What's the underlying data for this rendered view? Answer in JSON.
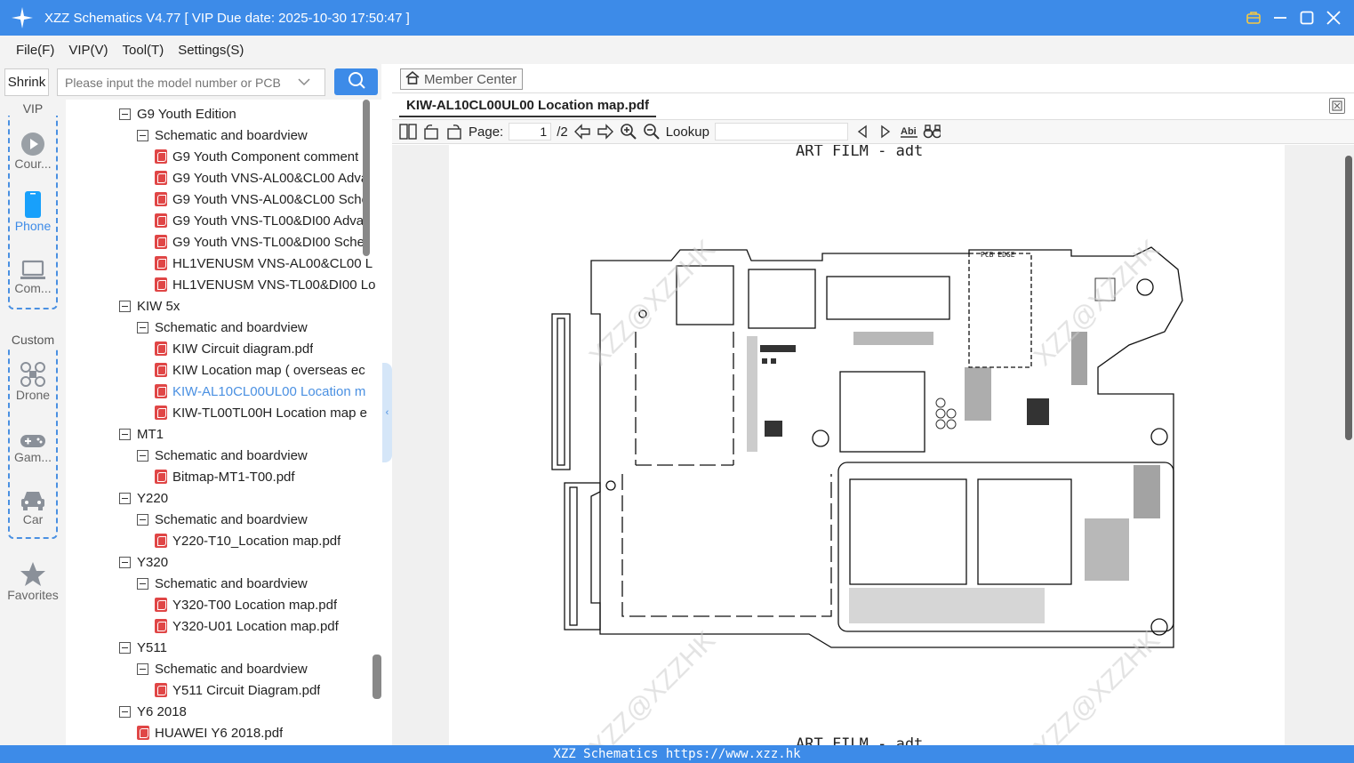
{
  "app": {
    "title": "XZZ Schematics V4.77 [ VIP Due date: 2025-10-30 17:50:47 ]",
    "menu": [
      "File(F)",
      "VIP(V)",
      "Tool(T)",
      "Settings(S)"
    ]
  },
  "search": {
    "shrink_label": "Shrink",
    "placeholder": "Please input the model number or PCB"
  },
  "sidebar": {
    "vip_label": "VIP",
    "custom_label": "Custom",
    "items": [
      {
        "label": "Cour...",
        "icon": "play-circle-icon"
      },
      {
        "label": "Phone",
        "icon": "phone-icon",
        "active": true
      },
      {
        "label": "Com...",
        "icon": "laptop-icon"
      },
      {
        "label": "Drone",
        "icon": "drone-icon"
      },
      {
        "label": "Gam...",
        "icon": "gamepad-icon"
      },
      {
        "label": "Car",
        "icon": "car-icon"
      },
      {
        "label": "Favorites",
        "icon": "star-icon"
      }
    ]
  },
  "tree": [
    {
      "label": "G9 Youth Edition",
      "type": "folder",
      "level": 0
    },
    {
      "label": "Schematic and boardview",
      "type": "folder",
      "level": 1
    },
    {
      "label": "G9 Youth Component comment",
      "type": "pdf",
      "level": 2
    },
    {
      "label": "G9 Youth VNS-AL00&CL00 Adva",
      "type": "pdf",
      "level": 2
    },
    {
      "label": "G9 Youth VNS-AL00&CL00 Sche",
      "type": "pdf",
      "level": 2
    },
    {
      "label": "G9 Youth VNS-TL00&DI00 Adva",
      "type": "pdf",
      "level": 2
    },
    {
      "label": "G9 Youth VNS-TL00&DI00 Sche",
      "type": "pdf",
      "level": 2
    },
    {
      "label": "HL1VENUSM VNS-AL00&CL00 L",
      "type": "pdf",
      "level": 2
    },
    {
      "label": "HL1VENUSM VNS-TL00&DI00 Lo",
      "type": "pdf",
      "level": 2
    },
    {
      "label": "KIW 5x",
      "type": "folder",
      "level": 0
    },
    {
      "label": "Schematic and boardview",
      "type": "folder",
      "level": 1
    },
    {
      "label": "KIW Circuit diagram.pdf",
      "type": "pdf",
      "level": 2
    },
    {
      "label": "KIW Location map ( overseas ec",
      "type": "pdf",
      "level": 2
    },
    {
      "label": "KIW-AL10CL00UL00 Location m",
      "type": "pdf",
      "level": 2,
      "selected": true
    },
    {
      "label": "KIW-TL00TL00H Location map e",
      "type": "pdf",
      "level": 2
    },
    {
      "label": "MT1",
      "type": "folder",
      "level": 0
    },
    {
      "label": "Schematic and boardview",
      "type": "folder",
      "level": 1
    },
    {
      "label": "Bitmap-MT1-T00.pdf",
      "type": "pdf",
      "level": 2
    },
    {
      "label": "Y220",
      "type": "folder",
      "level": 0
    },
    {
      "label": "Schematic and boardview",
      "type": "folder",
      "level": 1
    },
    {
      "label": "Y220-T10_Location map.pdf",
      "type": "pdf",
      "level": 2
    },
    {
      "label": "Y320",
      "type": "folder",
      "level": 0
    },
    {
      "label": "Schematic and boardview",
      "type": "folder",
      "level": 1
    },
    {
      "label": "Y320-T00 Location map.pdf",
      "type": "pdf",
      "level": 2
    },
    {
      "label": "Y320-U01 Location map.pdf",
      "type": "pdf",
      "level": 2
    },
    {
      "label": "Y511",
      "type": "folder",
      "level": 0
    },
    {
      "label": "Schematic and boardview",
      "type": "folder",
      "level": 1
    },
    {
      "label": "Y511 Circuit Diagram.pdf",
      "type": "pdf",
      "level": 2
    },
    {
      "label": "Y6 2018",
      "type": "folder",
      "level": 0
    },
    {
      "label": "HUAWEI Y6 2018.pdf",
      "type": "pdf",
      "level": 1
    }
  ],
  "viewer": {
    "member_center": "Member Center",
    "tab_title": "KIW-AL10CL00UL00 Location map.pdf",
    "page_label": "Page:",
    "page_current": "1",
    "page_total": "/2",
    "lookup_label": "Lookup",
    "pdf_header": "ART FILM - adt",
    "pdf_footer": "ART FILM - adt",
    "pcb_edge_label": "PCB EDGE",
    "watermark": "XZZ@XZZHK"
  },
  "status": {
    "text": "XZZ Schematics https://www.xzz.hk"
  },
  "colors": {
    "accent": "#3d8be8",
    "selected_text": "#4a90e2",
    "pdf_icon": "#e04646"
  }
}
